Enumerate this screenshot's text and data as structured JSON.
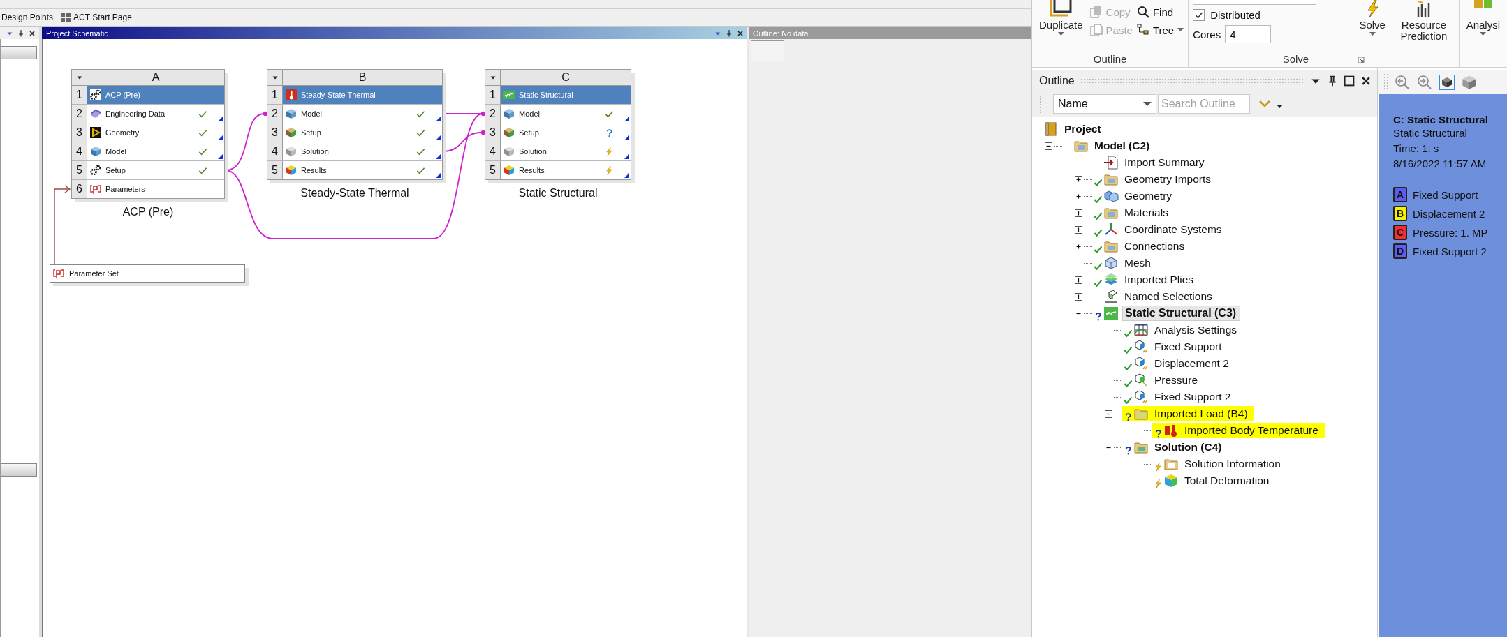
{
  "workbench": {
    "toolbar": [
      {
        "label": "Design Points",
        "kind": "text"
      },
      {
        "label": "ACT Start Page",
        "kind": "page"
      }
    ],
    "schematic": {
      "title": "Project Schematic",
      "systems": [
        {
          "letter": "A",
          "name": "ACP (Pre)",
          "cells": [
            {
              "number": "1",
              "label": "ACP (Pre)",
              "kind": "acp",
              "flag": false
            },
            {
              "number": "2",
              "label": "Engineering Data",
              "kind": "engineering-data",
              "status": {
                "kind": "check"
              },
              "flag": true
            },
            {
              "number": "3",
              "label": "Geometry",
              "kind": "geometry",
              "status": {
                "kind": "check"
              },
              "flag": true
            },
            {
              "number": "4",
              "label": "Model",
              "kind": "model",
              "status": {
                "kind": "check"
              },
              "flag": true
            },
            {
              "number": "5",
              "label": "Setup",
              "kind": "acp-setup",
              "status": {
                "kind": "check"
              },
              "flag": false
            },
            {
              "number": "6",
              "label": "Parameters",
              "kind": "parameters",
              "flag": false
            }
          ]
        },
        {
          "letter": "B",
          "name": "Steady-State Thermal",
          "cells": [
            {
              "number": "1",
              "label": "Steady-State Thermal",
              "kind": "thermal",
              "flag": false
            },
            {
              "number": "2",
              "label": "Model",
              "kind": "model",
              "status": {
                "kind": "check"
              },
              "flag": true
            },
            {
              "number": "3",
              "label": "Setup",
              "kind": "setup",
              "status": {
                "kind": "check"
              },
              "flag": true
            },
            {
              "number": "4",
              "label": "Solution",
              "kind": "solution",
              "status": {
                "kind": "check"
              },
              "flag": true
            },
            {
              "number": "5",
              "label": "Results",
              "kind": "results",
              "status": {
                "kind": "check"
              },
              "flag": true
            }
          ]
        },
        {
          "letter": "C",
          "name": "Static Structural",
          "cells": [
            {
              "number": "1",
              "label": "Static Structural",
              "kind": "structural",
              "flag": false
            },
            {
              "number": "2",
              "label": "Model",
              "kind": "model",
              "status": {
                "kind": "check"
              },
              "flag": true
            },
            {
              "number": "3",
              "label": "Setup",
              "kind": "setup",
              "status": {
                "kind": "question"
              },
              "flag": true
            },
            {
              "number": "4",
              "label": "Solution",
              "kind": "solution",
              "status": {
                "kind": "lightning"
              },
              "flag": true
            },
            {
              "number": "5",
              "label": "Results",
              "kind": "results",
              "status": {
                "kind": "lightning"
              },
              "flag": true
            }
          ]
        }
      ],
      "parameter_set": {
        "label": "Parameter Set"
      }
    },
    "outline_pane": {
      "title": "Outline: No data"
    }
  },
  "mechanical": {
    "ribbon": {
      "duplicate": "Duplicate",
      "copy": {
        "label": "Copy",
        "disabled": true
      },
      "paste": {
        "label": "Paste",
        "disabled": true
      },
      "find": "Find",
      "tree": "Tree",
      "outline_group": "Outline",
      "distributed": {
        "label": "Distributed",
        "checked": true
      },
      "cores": {
        "label": "Cores",
        "value": "4"
      },
      "solve": "Solve",
      "resource_prediction": "Resource Prediction",
      "solve_group": "Solve",
      "analysis": "Analysi"
    },
    "outline": {
      "title": "Outline",
      "filter": {
        "value": "Name"
      },
      "search": {
        "placeholder": "Search Outline"
      },
      "tree": [
        {
          "label": "Project",
          "kind": "project",
          "bold": true,
          "selected": false,
          "highlighted": false,
          "children": [
            {
              "label": "Model (C2)",
              "kind": "model-folder",
              "bold": true,
              "expanded": true,
              "selected": false,
              "highlighted": false,
              "children": [
                {
                  "label": "Import Summary",
                  "kind": "import-summary",
                  "bold": false,
                  "selected": false,
                  "highlighted": false
                },
                {
                  "label": "Geometry Imports",
                  "kind": "folder",
                  "bold": false,
                  "expanded": false,
                  "status": {
                    "kind": "check"
                  },
                  "selected": false,
                  "highlighted": false
                },
                {
                  "label": "Geometry",
                  "kind": "geometry",
                  "bold": false,
                  "expanded": false,
                  "status": {
                    "kind": "check"
                  },
                  "selected": false,
                  "highlighted": false
                },
                {
                  "label": "Materials",
                  "kind": "folder",
                  "bold": false,
                  "expanded": false,
                  "status": {
                    "kind": "check"
                  },
                  "selected": false,
                  "highlighted": false
                },
                {
                  "label": "Coordinate Systems",
                  "kind": "coordinates",
                  "bold": false,
                  "expanded": false,
                  "status": {
                    "kind": "check"
                  },
                  "selected": false,
                  "highlighted": false
                },
                {
                  "label": "Connections",
                  "kind": "folder",
                  "bold": false,
                  "expanded": false,
                  "status": {
                    "kind": "check"
                  },
                  "selected": false,
                  "highlighted": false
                },
                {
                  "label": "Mesh",
                  "kind": "mesh",
                  "bold": false,
                  "status": {
                    "kind": "check"
                  },
                  "selected": false,
                  "highlighted": false
                },
                {
                  "label": "Imported Plies",
                  "kind": "plies",
                  "bold": false,
                  "expanded": false,
                  "status": {
                    "kind": "check"
                  },
                  "selected": false,
                  "highlighted": false
                },
                {
                  "label": "Named Selections",
                  "kind": "named-selections",
                  "bold": false,
                  "expanded": false,
                  "selected": false,
                  "highlighted": false
                },
                {
                  "label": "Static Structural (C3)",
                  "kind": "structural",
                  "bold": true,
                  "expanded": true,
                  "status": {
                    "kind": "question"
                  },
                  "selected": true,
                  "highlighted": false,
                  "children": [
                    {
                      "label": "Analysis Settings",
                      "kind": "analysis-settings",
                      "bold": false,
                      "status": {
                        "kind": "check"
                      },
                      "selected": false,
                      "highlighted": false
                    },
                    {
                      "label": "Fixed Support",
                      "kind": "support",
                      "bold": false,
                      "status": {
                        "kind": "check"
                      },
                      "selected": false,
                      "highlighted": false
                    },
                    {
                      "label": "Displacement 2",
                      "kind": "support",
                      "bold": false,
                      "status": {
                        "kind": "check"
                      },
                      "selected": false,
                      "highlighted": false
                    },
                    {
                      "label": "Pressure",
                      "kind": "load",
                      "bold": false,
                      "status": {
                        "kind": "check"
                      },
                      "selected": false,
                      "highlighted": false
                    },
                    {
                      "label": "Fixed Support 2",
                      "kind": "support",
                      "bold": false,
                      "status": {
                        "kind": "check"
                      },
                      "selected": false,
                      "highlighted": false
                    },
                    {
                      "label": "Imported Load (B4)",
                      "kind": "import-folder",
                      "bold": false,
                      "expanded": true,
                      "status": {
                        "kind": "question"
                      },
                      "selected": false,
                      "highlighted": true,
                      "children": [
                        {
                          "label": "Imported Body Temperature",
                          "kind": "temperature",
                          "bold": false,
                          "status": {
                            "kind": "question"
                          },
                          "selected": false,
                          "highlighted": true
                        }
                      ]
                    },
                    {
                      "label": "Solution (C4)",
                      "kind": "solution-folder",
                      "bold": true,
                      "expanded": true,
                      "status": {
                        "kind": "question"
                      },
                      "selected": false,
                      "highlighted": false,
                      "children": [
                        {
                          "label": "Solution Information",
                          "kind": "info-folder",
                          "bold": false,
                          "status": {
                            "kind": "lightning"
                          },
                          "selected": false,
                          "highlighted": false
                        },
                        {
                          "label": "Total Deformation",
                          "kind": "deformation",
                          "bold": false,
                          "status": {
                            "kind": "lightning"
                          },
                          "selected": false,
                          "highlighted": false
                        }
                      ]
                    }
                  ]
                }
              ]
            }
          ]
        }
      ]
    },
    "viewport": {
      "legend": {
        "title": "C: Static Structural",
        "lines": [
          "Static Structural",
          "Time: 1. s",
          "8/16/2022 11:57 AM"
        ],
        "items": [
          {
            "letter": "A",
            "label": "Fixed Support",
            "color": "#5c5cf0"
          },
          {
            "letter": "B",
            "label": "Displacement 2",
            "color": "#f6f200"
          },
          {
            "letter": "C",
            "label": "Pressure: 1. MP",
            "color": "#f03030"
          },
          {
            "letter": "D",
            "label": "Fixed Support 2",
            "color": "#5c5cf0"
          }
        ]
      }
    }
  }
}
